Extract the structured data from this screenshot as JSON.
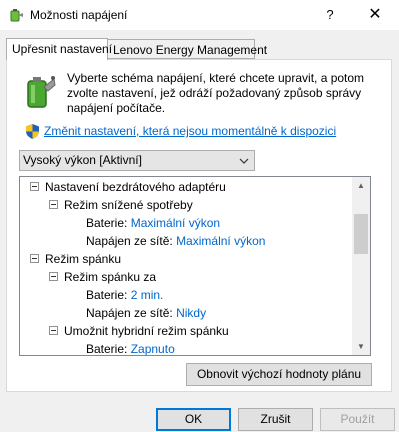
{
  "window": {
    "title": "Možnosti napájení",
    "help_glyph": "?",
    "close_glyph": "✕"
  },
  "tabs": [
    {
      "label": "Upřesnit nastavení",
      "selected": true
    },
    {
      "label": "Lenovo Energy Management",
      "selected": false
    }
  ],
  "intro": {
    "description": "Vyberte schéma napájení, které chcete upravit, a potom zvolte nastavení, jež odráží požadovaný způsob správy napájení počítače.",
    "change_link": "Změnit nastavení, která nejsou momentálně k dispozici"
  },
  "plan_select": {
    "value": "Vysoký výkon [Aktivní]"
  },
  "tree": {
    "items": [
      {
        "label": "Nastavení bezdrátového adaptéru",
        "level": 0,
        "toggle": true
      },
      {
        "label": "Režim snížené spotřeby",
        "level": 1,
        "toggle": true
      },
      {
        "label": "Baterie:",
        "value": "Maximální výkon",
        "level": 2
      },
      {
        "label": "Napájen ze sítě:",
        "value": "Maximální výkon",
        "level": 2
      },
      {
        "label": "Režim spánku",
        "level": 0,
        "toggle": true
      },
      {
        "label": "Režim spánku za",
        "level": 1,
        "toggle": true
      },
      {
        "label": "Baterie:",
        "value": "2 min.",
        "level": 2
      },
      {
        "label": "Napájen ze sítě:",
        "value": "Nikdy",
        "level": 2
      },
      {
        "label": "Umožnit hybridní režim spánku",
        "level": 1,
        "toggle": true
      },
      {
        "label": "Baterie:",
        "value": "Zapnuto",
        "level": 2
      }
    ]
  },
  "buttons": {
    "restore": "Obnovit výchozí hodnoty plánu",
    "ok": "OK",
    "cancel": "Zrušit",
    "apply": "Použít"
  },
  "colors": {
    "link": "#0066cc",
    "dialog_bg": "#f0f0f0",
    "focus_border": "#0078d7"
  }
}
